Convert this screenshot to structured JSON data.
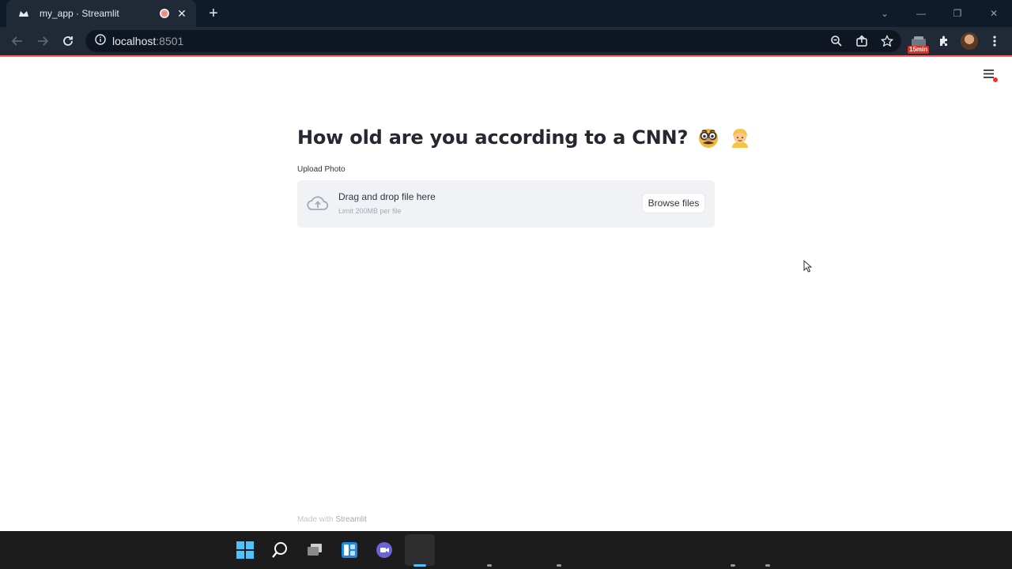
{
  "browser": {
    "tab_title": "my_app · Streamlit",
    "tab_close": "✕",
    "new_tab": "+",
    "url_host": "localhost",
    "url_port": ":8501",
    "extension_badge": "15min",
    "window_controls": [
      "⌄",
      "—",
      "❐",
      "✕"
    ]
  },
  "app": {
    "title": "How old are you according to a CNN?",
    "title_emojis": [
      "nerd-disguise-face",
      "person-blond-hair"
    ],
    "uploader": {
      "label": "Upload Photo",
      "drag_text": "Drag and drop file here",
      "limit_text": "Limit 200MB per file",
      "browse_label": "Browse files"
    },
    "footer_prefix": "Made with",
    "footer_brand": "Streamlit"
  },
  "colors": {
    "accent": "#ff4b4b",
    "title_text": "#262730",
    "dropzone_bg": "#f0f2f6",
    "chrome_bg": "#202a36"
  }
}
